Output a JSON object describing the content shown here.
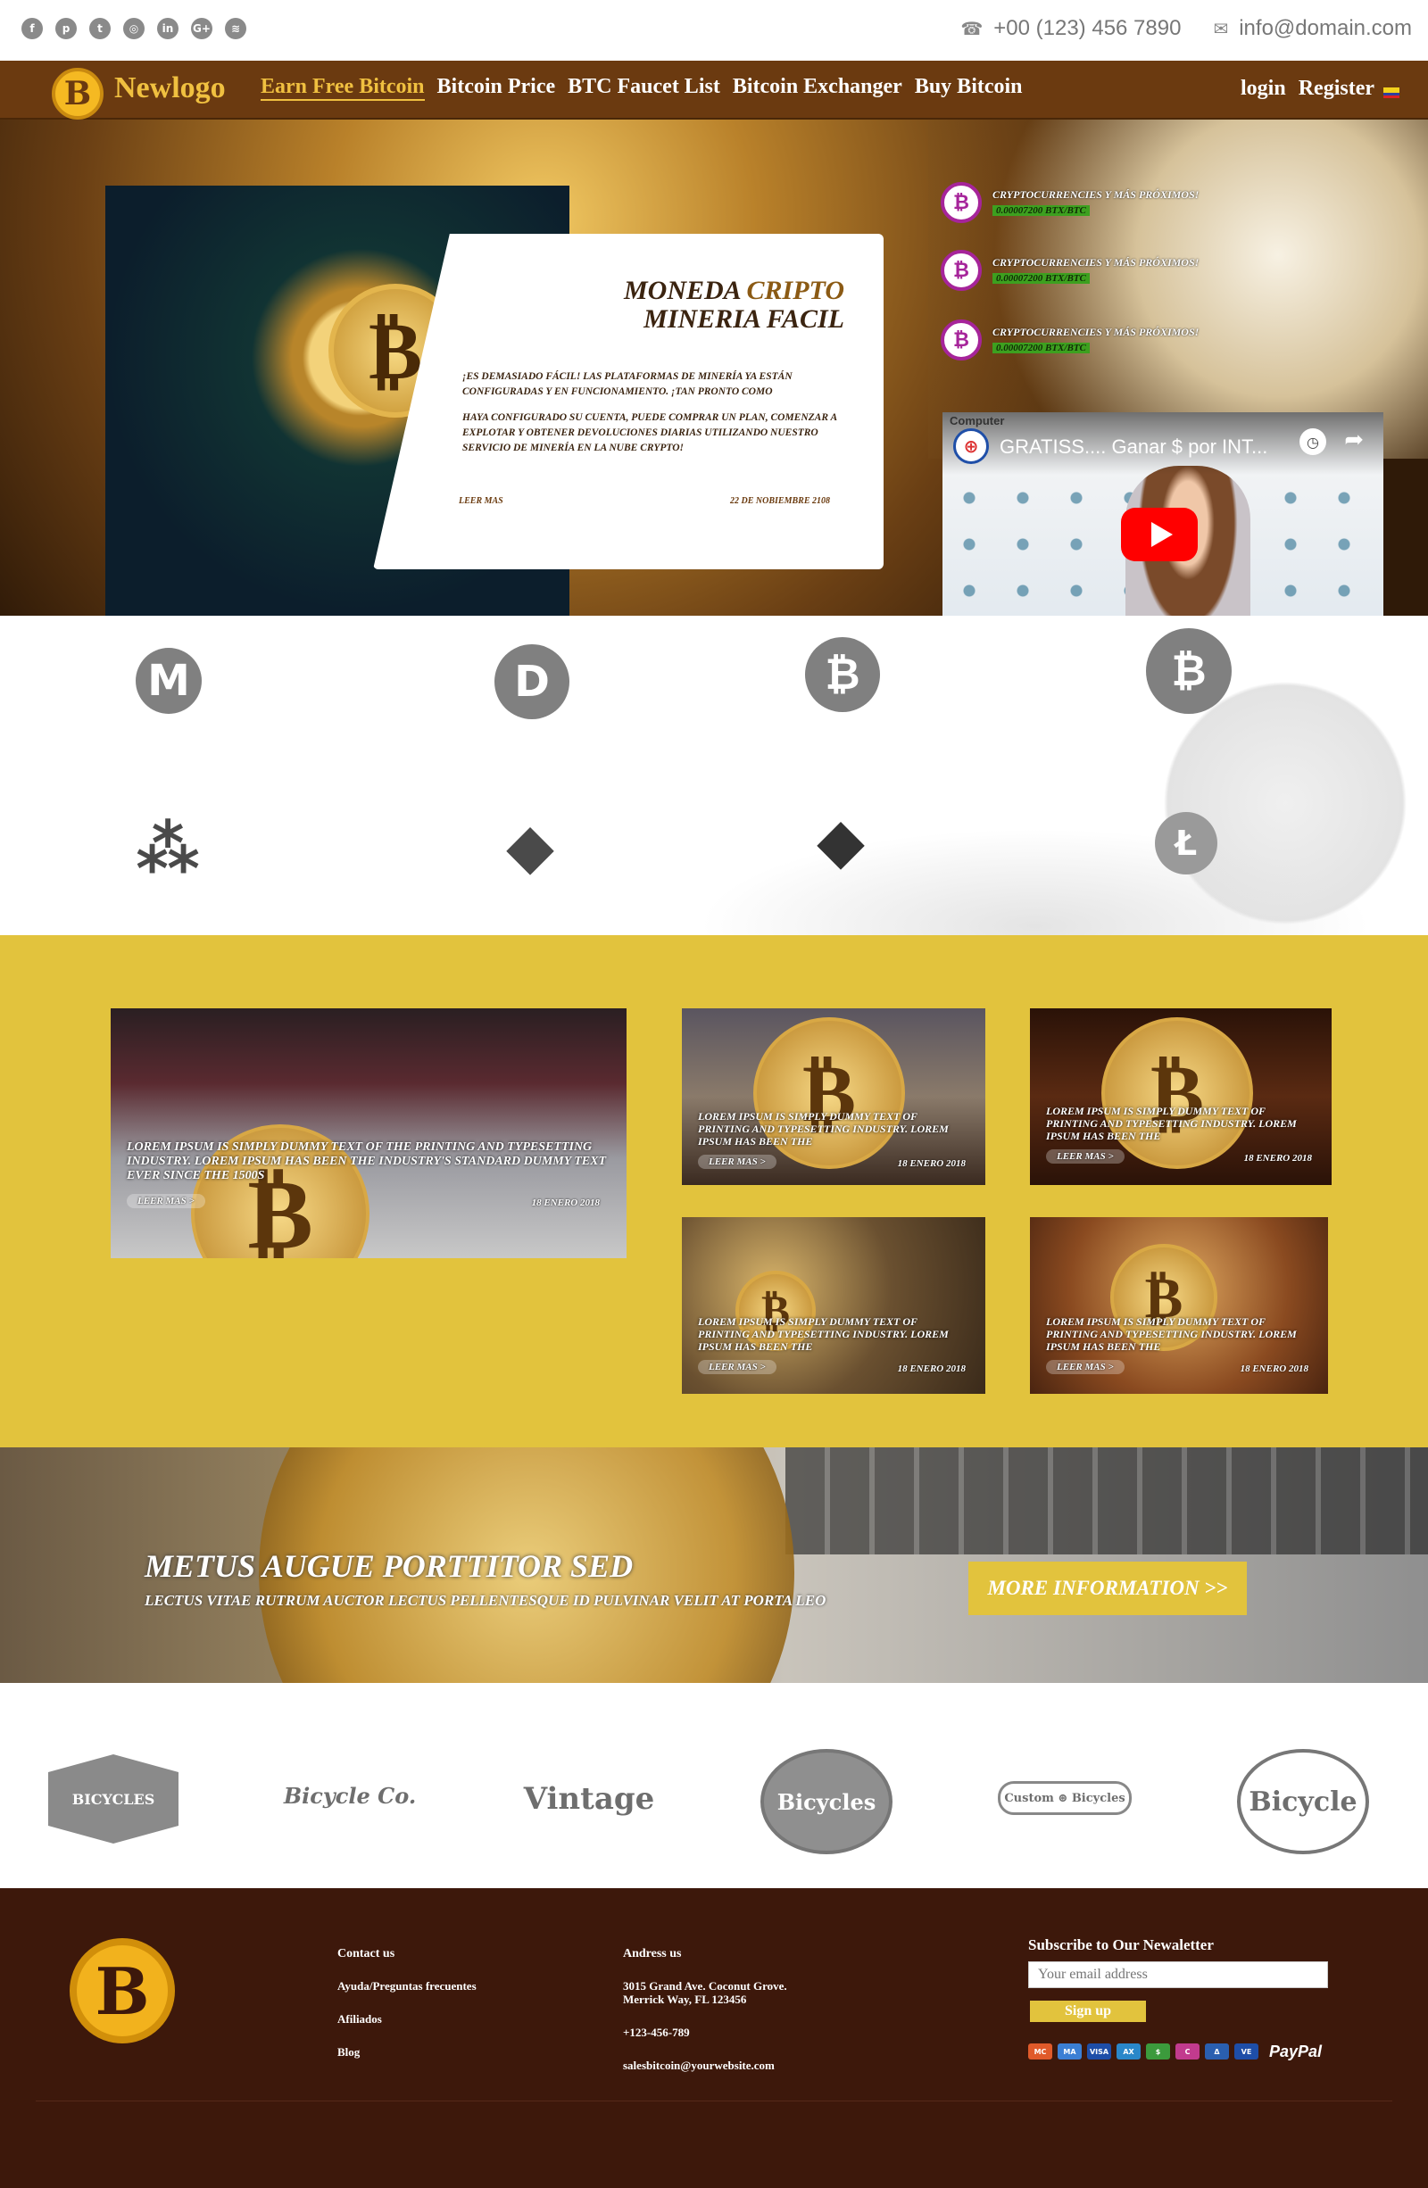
{
  "topbar": {
    "socials": [
      {
        "name": "facebook-icon",
        "glyph": "f"
      },
      {
        "name": "pinterest-icon",
        "glyph": "p"
      },
      {
        "name": "twitter-icon",
        "glyph": "t"
      },
      {
        "name": "dribbble-icon",
        "glyph": "◎"
      },
      {
        "name": "linkedin-icon",
        "glyph": "in"
      },
      {
        "name": "google-plus-icon",
        "glyph": "G+"
      },
      {
        "name": "rss-icon",
        "glyph": "≋"
      }
    ],
    "phone": "+00 (123) 456 7890",
    "email": "info@domain.com"
  },
  "nav": {
    "logo_text": "Newlogo",
    "logo_glyph": "B",
    "items": [
      "Earn Free Bitcoin",
      "Bitcoin Price",
      "BTC Faucet List",
      "Bitcoin Exchanger",
      "Buy Bitcoin"
    ],
    "login": "login",
    "register": "Register"
  },
  "hero": {
    "title_line1_a": "MONEDA ",
    "title_line1_b": "CRIPTO",
    "title_line2": "MINERIA FACIL",
    "paragraph1": "¡ES DEMASIADO FÁCIL!  LAS PLATAFORMAS DE MINERÍA YA ESTÁN CONFIGURADAS Y EN FUNCIONAMIENTO.  ¡TAN PRONTO COMO",
    "paragraph2": "HAYA CONFIGURADO SU CUENTA, PUEDE COMPRAR UN PLAN, COMENZAR A EXPLOTAR Y OBTENER DEVOLUCIONES DIARIAS UTILIZANDO NUESTRO SERVICIO DE MINERÍA EN LA NUBE CRYPTO!",
    "read_more": "LEER MAS",
    "date": "22 DE NOBIEMBRE 2108",
    "tickers": [
      {
        "label": "CRYPTOCURRENCIES Y MÁS PRÓXIMOS!",
        "price": "0.00007200 BTX/BTC"
      },
      {
        "label": "CRYPTOCURRENCIES Y MÁS PRÓXIMOS!",
        "price": "0.00007200 BTX/BTC"
      },
      {
        "label": "CRYPTOCURRENCIES Y MÁS PRÓXIMOS!",
        "price": "0.00007200 BTX/BTC"
      }
    ],
    "video": {
      "brand": "Computer",
      "title": "GRATISS.... Ganar $ por INT..."
    }
  },
  "crypto_icons": [
    {
      "name": "monero-icon",
      "glyph": "M"
    },
    {
      "name": "dash-icon",
      "glyph": "D"
    },
    {
      "name": "bitcoin-icon",
      "glyph": "₿"
    },
    {
      "name": "bitcoin-icon",
      "glyph": "₿"
    },
    {
      "name": "ripple-icon",
      "glyph": "⁂"
    },
    {
      "name": "ethereum-icon",
      "glyph": "◆"
    },
    {
      "name": "ethereum-icon",
      "glyph": "◆"
    },
    {
      "name": "litecoin-icon",
      "glyph": "Ł"
    }
  ],
  "news": [
    {
      "text": "LOREM IPSUM IS SIMPLY DUMMY TEXT OF THE PRINTING AND TYPESETTING INDUSTRY. LOREM IPSUM HAS BEEN THE INDUSTRY'S STANDARD DUMMY TEXT EVER SINCE THE 1500S",
      "more": "LEER MAS >",
      "date": "18 ENERO 2018"
    },
    {
      "text": "LOREM IPSUM IS SIMPLY DUMMY TEXT OF PRINTING AND TYPESETTING INDUSTRY. LOREM IPSUM HAS BEEN THE",
      "more": "LEER MAS >",
      "date": "18 ENERO 2018"
    },
    {
      "text": "LOREM IPSUM IS SIMPLY DUMMY TEXT OF PRINTING AND TYPESETTING INDUSTRY. LOREM IPSUM HAS BEEN THE",
      "more": "LEER MAS >",
      "date": "18 ENERO 2018"
    },
    {
      "text": "LOREM IPSUM IS SIMPLY DUMMY TEXT OF PRINTING AND TYPESETTING INDUSTRY. LOREM IPSUM HAS BEEN THE",
      "more": "LEER MAS >",
      "date": "18 ENERO 2018"
    },
    {
      "text": "LOREM IPSUM IS SIMPLY DUMMY TEXT OF PRINTING AND TYPESETTING INDUSTRY. LOREM IPSUM HAS BEEN THE",
      "more": "LEER MAS >",
      "date": "18 ENERO 2018"
    }
  ],
  "banner": {
    "title": "METUS AUGUE PORTTITOR SED",
    "subtitle": "LECTUS VITAE RUTRUM AUCTOR LECTUS PELLENTESQUE ID PULVINAR VELIT AT PORTA LEO",
    "button": "MORE INFORMATION  >>"
  },
  "partners": [
    {
      "name": "bicycles-badge-logo",
      "text": "BICYCLES"
    },
    {
      "name": "bicycle-co-logo",
      "text": "Bicycle Co."
    },
    {
      "name": "vintage-logo",
      "text": "Vintage"
    },
    {
      "name": "bicycles-round-logo",
      "text": "Bicycles"
    },
    {
      "name": "custom-bicycles-logo",
      "text": "Custom ⊛ Bicycles"
    },
    {
      "name": "bicycle-circle-logo",
      "text": "Bicycle"
    }
  ],
  "footer": {
    "logo_glyph": "B",
    "contact_heading": "Contact us",
    "contact_links": [
      "Ayuda/Preguntas frecuentes",
      "Afiliados",
      "Blog"
    ],
    "address_heading": "Andress us",
    "address_line1": "3015 Grand Ave. Coconut Grove.",
    "address_line2": "Merrick Way, FL 123456",
    "phone": "+123-456-789",
    "email": "salesbitcoin@yourwebsite.com",
    "subscribe_title": "Subscribe to Our Newaletter",
    "email_placeholder": "Your email address",
    "signup": "Sign up",
    "payments": [
      {
        "name": "mastercard-icon",
        "glyph": "MC",
        "color": "#e05a2a"
      },
      {
        "name": "maestro-icon",
        "glyph": "MA",
        "color": "#3b7fd4"
      },
      {
        "name": "visa-icon",
        "glyph": "VISA",
        "color": "#1e4ea8"
      },
      {
        "name": "amex-icon",
        "glyph": "AX",
        "color": "#2a87c9"
      },
      {
        "name": "cash-icon",
        "glyph": "$",
        "color": "#3c9a3c"
      },
      {
        "name": "cirrus-icon",
        "glyph": "C",
        "color": "#c23b8e"
      },
      {
        "name": "delta-icon",
        "glyph": "Δ",
        "color": "#2a5fb0"
      },
      {
        "name": "visa-electron-icon",
        "glyph": "VE",
        "color": "#1e4ea8"
      }
    ],
    "paypal": "PayPal"
  }
}
